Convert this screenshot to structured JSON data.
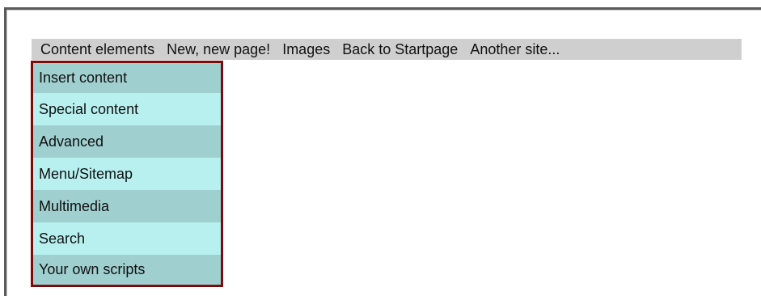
{
  "menubar": {
    "items": [
      {
        "label": "Content elements"
      },
      {
        "label": "New, new page!"
      },
      {
        "label": "Images"
      },
      {
        "label": "Back to Startpage"
      },
      {
        "label": "Another site..."
      }
    ]
  },
  "submenu": {
    "items": [
      {
        "label": "Insert content"
      },
      {
        "label": "Special content"
      },
      {
        "label": "Advanced"
      },
      {
        "label": "Menu/Sitemap"
      },
      {
        "label": "Multimedia"
      },
      {
        "label": "Search"
      },
      {
        "label": "Your own scripts"
      }
    ]
  },
  "colors": {
    "menubar_bg": "#cfcfcf",
    "submenu_border": "#7a0c0c",
    "submenu_row_dark": "#9fcfcf",
    "submenu_row_light": "#b8f0f0"
  }
}
